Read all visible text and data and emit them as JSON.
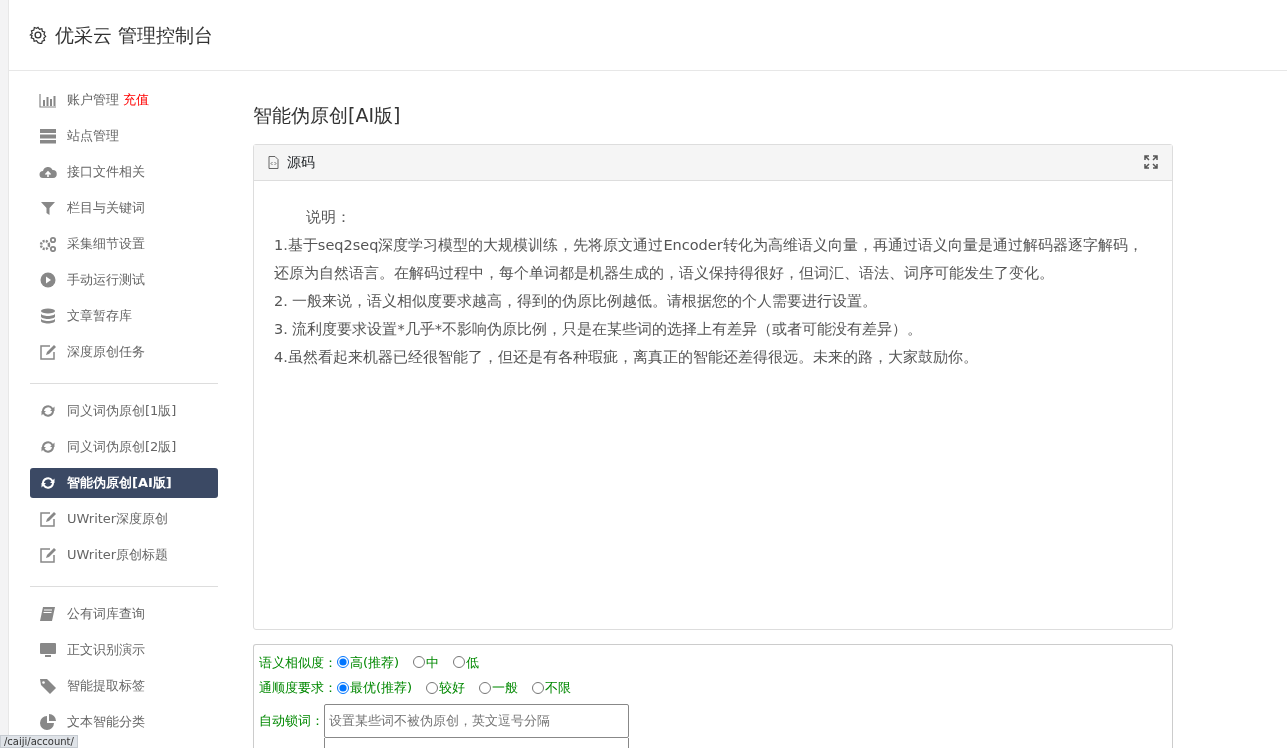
{
  "header": {
    "title": "优采云 管理控制台"
  },
  "sidebar": {
    "groups": [
      {
        "items": [
          {
            "label": "账户管理",
            "badge": "充值",
            "selected": false
          },
          {
            "label": "站点管理",
            "selected": false
          },
          {
            "label": "接口文件相关",
            "selected": false
          },
          {
            "label": "栏目与关键词",
            "selected": false
          },
          {
            "label": "采集细节设置",
            "selected": false
          },
          {
            "label": "手动运行测试",
            "selected": false
          },
          {
            "label": "文章暂存库",
            "selected": false
          },
          {
            "label": "深度原创任务",
            "selected": false
          }
        ]
      },
      {
        "items": [
          {
            "label": "同义词伪原创[1版]",
            "selected": false
          },
          {
            "label": "同义词伪原创[2版]",
            "selected": false
          },
          {
            "label": "智能伪原创[AI版]",
            "selected": true
          },
          {
            "label": "UWriter深度原创",
            "selected": false
          },
          {
            "label": "UWriter原创标题",
            "selected": false
          }
        ]
      },
      {
        "items": [
          {
            "label": "公有词库查询",
            "selected": false
          },
          {
            "label": "正文识别演示",
            "selected": false
          },
          {
            "label": "智能提取标签",
            "selected": false
          },
          {
            "label": "文本智能分类",
            "selected": false
          }
        ]
      }
    ]
  },
  "page_title": "智能伪原创[AI版]",
  "editor": {
    "toolbar_label": "源码",
    "paragraphs": [
      "说明：",
      "1.基于seq2seq深度学习模型的大规模训练，先将原文通过Encoder转化为高维语义向量，再通过语义向量是通过解码器逐字解码，还原为自然语言。在解码过程中，每个单词都是机器生成的，语义保持得很好，但词汇、语法、词序可能发生了变化。",
      "2. 一般来说，语义相似度要求越高，得到的伪原比例越低。请根据您的个人需要进行设置。",
      "3. 流利度要求设置*几乎*不影响伪原比例，只是在某些词的选择上有差异（或者可能没有差异）。",
      "4.虽然看起来机器已经很智能了，但还是有各种瑕疵，离真正的智能还差得很远。未来的路，大家鼓励你。"
    ]
  },
  "options": [
    {
      "kind": "radio",
      "label": "语义相似度：",
      "choices": [
        {
          "label": "高(推荐)",
          "selected": true
        },
        {
          "label": "中",
          "selected": false
        },
        {
          "label": "低",
          "selected": false
        }
      ]
    },
    {
      "kind": "radio",
      "label": "通顺度要求：",
      "choices": [
        {
          "label": "最优(推荐)",
          "selected": true
        },
        {
          "label": "较好",
          "selected": false
        },
        {
          "label": "一般",
          "selected": false
        },
        {
          "label": "不限",
          "selected": false
        }
      ]
    },
    {
      "kind": "text",
      "label": "自动锁词：",
      "placeholder": "设置某些词不被伪原创，英文逗号分隔"
    }
  ],
  "status_bar": {
    "url": "/caiji/account/"
  }
}
